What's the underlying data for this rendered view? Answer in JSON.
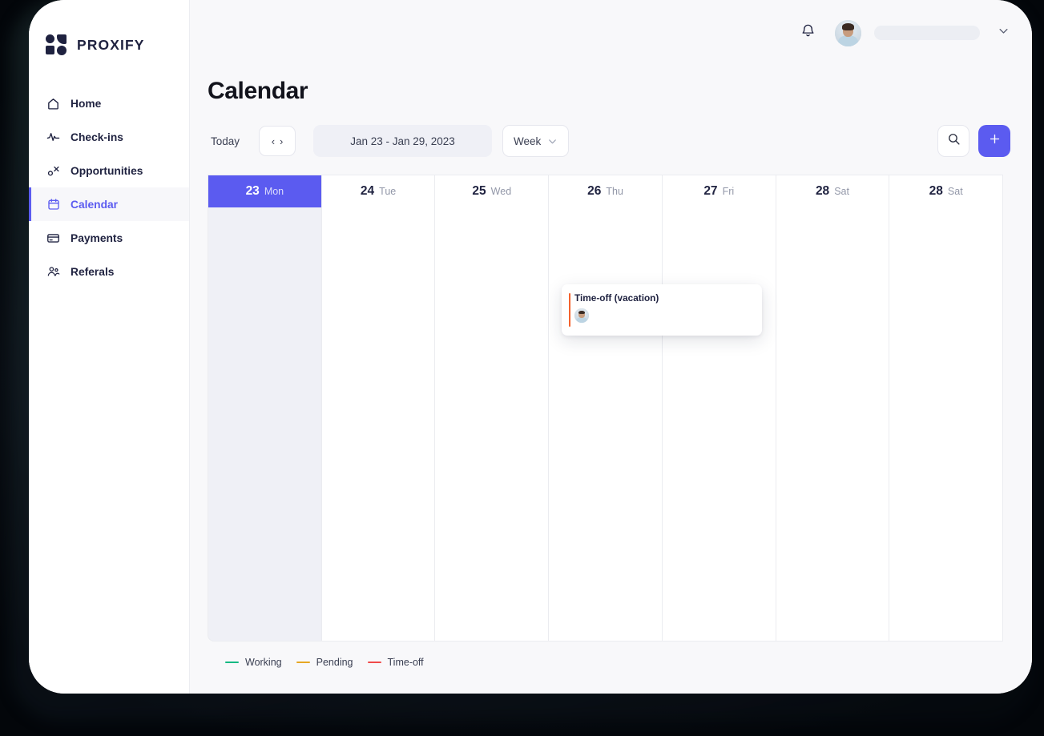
{
  "brand": {
    "name": "PROXIFY",
    "logo_icon": "proxify-logo-icon"
  },
  "sidebar": {
    "items": [
      {
        "label": "Home",
        "icon": "home-icon",
        "active": false
      },
      {
        "label": "Check-ins",
        "icon": "pulse-icon",
        "active": false
      },
      {
        "label": "Opportunities",
        "icon": "opportunities-icon",
        "active": false
      },
      {
        "label": "Calendar",
        "icon": "calendar-icon",
        "active": true
      },
      {
        "label": "Payments",
        "icon": "card-icon",
        "active": false
      },
      {
        "label": "Referals",
        "icon": "people-icon",
        "active": false
      }
    ]
  },
  "topbar": {
    "bell_icon": "bell-icon",
    "avatar_icon": "user-avatar",
    "account_name": "",
    "chevron_icon": "chevron-down-icon"
  },
  "page": {
    "title": "Calendar"
  },
  "toolbar": {
    "today_label": "Today",
    "prev_icon": "chevron-left-icon",
    "next_icon": "chevron-right-icon",
    "prev_glyph": "‹",
    "next_glyph": "›",
    "date_range": "Jan 23 - Jan 29, 2023",
    "view_label": "Week",
    "view_chevron_icon": "chevron-down-icon",
    "search_icon": "search-icon",
    "add_icon": "plus-icon"
  },
  "calendar": {
    "days": [
      {
        "num": "23",
        "name": "Mon",
        "today": true
      },
      {
        "num": "24",
        "name": "Tue",
        "today": false
      },
      {
        "num": "25",
        "name": "Wed",
        "today": false
      },
      {
        "num": "26",
        "name": "Thu",
        "today": false
      },
      {
        "num": "27",
        "name": "Fri",
        "today": false
      },
      {
        "num": "28",
        "name": "Sat",
        "today": false
      },
      {
        "num": "28",
        "name": "Sat",
        "today": false
      }
    ],
    "events": [
      {
        "title": "Time-off (vacation)",
        "accent_color": "#f4622d",
        "attendee_icon": "attendee-avatar",
        "day_index": 3
      }
    ]
  },
  "legend": [
    {
      "label": "Working",
      "color": "#11b982"
    },
    {
      "label": "Pending",
      "color": "#e6a723"
    },
    {
      "label": "Time-off",
      "color": "#f04a4a"
    }
  ],
  "colors": {
    "accent": "#5b5bf0",
    "today_column": "#eff0f6",
    "page_bg": "#f8f8fa",
    "text": "#1f2240"
  }
}
